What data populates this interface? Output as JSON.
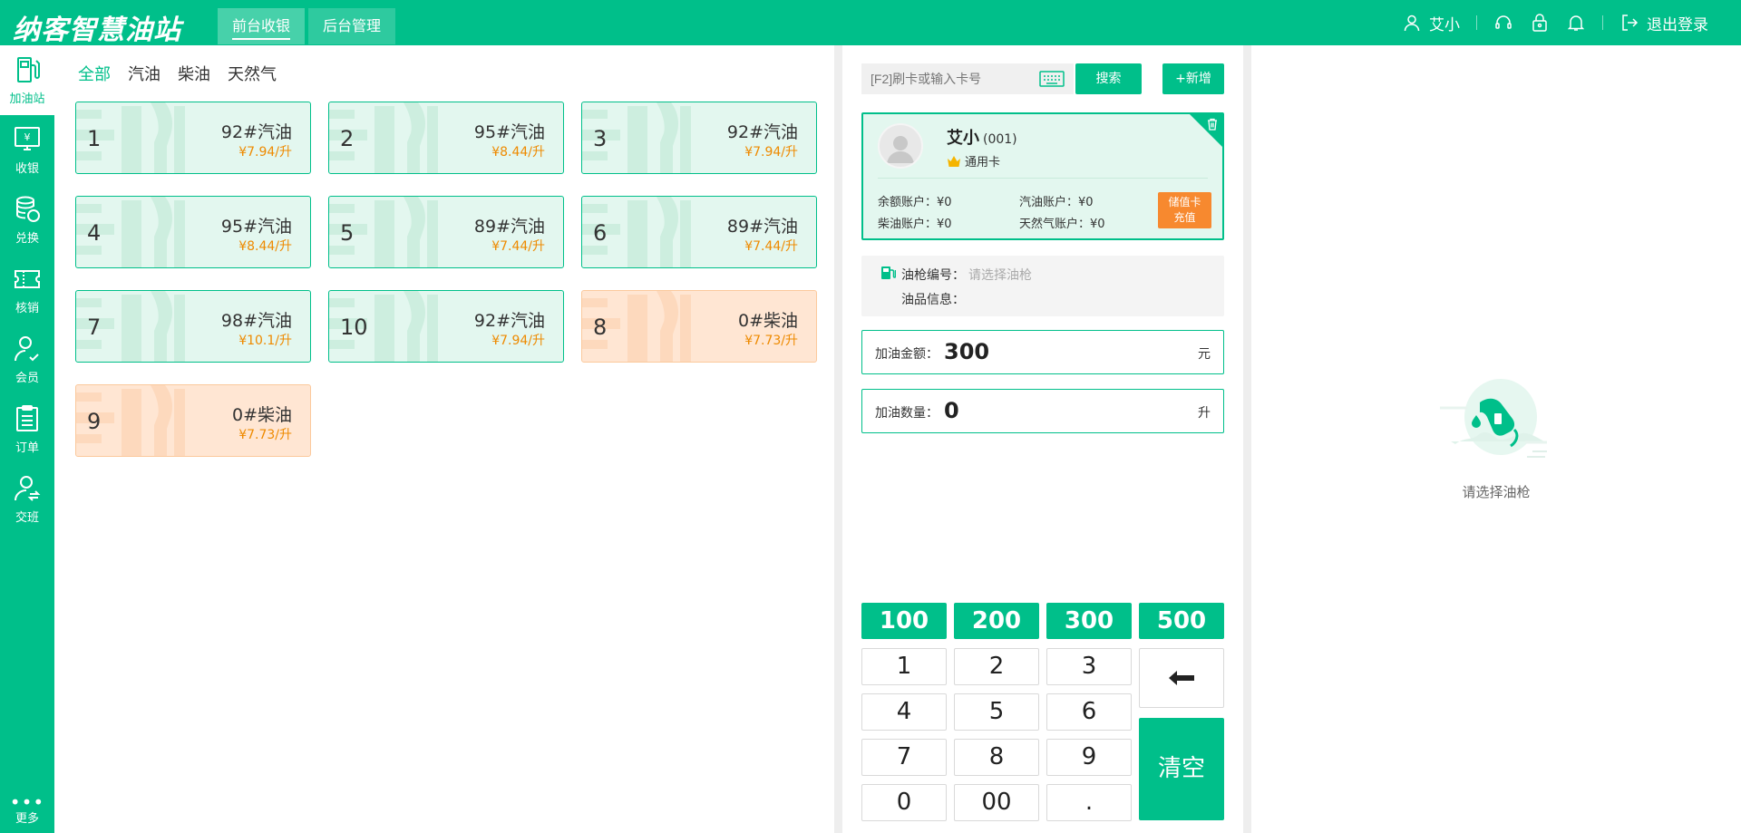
{
  "header": {
    "logo": "纳客智慧油站",
    "tabs": [
      {
        "label": "前台收银",
        "active": true
      },
      {
        "label": "后台管理",
        "active": false
      }
    ],
    "user_name": "艾小",
    "logout_label": "退出登录"
  },
  "sidebar": {
    "items": [
      {
        "label": "加油站",
        "icon": "fuel-pump-icon",
        "active": true
      },
      {
        "label": "收银",
        "icon": "cashier-icon",
        "active": false
      },
      {
        "label": "兑换",
        "icon": "exchange-icon",
        "active": false
      },
      {
        "label": "核销",
        "icon": "ticket-icon",
        "active": false
      },
      {
        "label": "会员",
        "icon": "member-icon",
        "active": false
      },
      {
        "label": "订单",
        "icon": "order-icon",
        "active": false
      },
      {
        "label": "交班",
        "icon": "shift-icon",
        "active": false
      }
    ],
    "more_label": "更多"
  },
  "filters": [
    "全部",
    "汽油",
    "柴油",
    "天然气"
  ],
  "pumps": [
    {
      "number": "1",
      "fuel": "92#汽油",
      "price": "¥7.94/升",
      "kind": "gasoline"
    },
    {
      "number": "2",
      "fuel": "95#汽油",
      "price": "¥8.44/升",
      "kind": "gasoline"
    },
    {
      "number": "3",
      "fuel": "92#汽油",
      "price": "¥7.94/升",
      "kind": "gasoline"
    },
    {
      "number": "4",
      "fuel": "95#汽油",
      "price": "¥8.44/升",
      "kind": "gasoline"
    },
    {
      "number": "5",
      "fuel": "89#汽油",
      "price": "¥7.44/升",
      "kind": "gasoline"
    },
    {
      "number": "6",
      "fuel": "89#汽油",
      "price": "¥7.44/升",
      "kind": "gasoline"
    },
    {
      "number": "7",
      "fuel": "98#汽油",
      "price": "¥10.1/升",
      "kind": "gasoline"
    },
    {
      "number": "10",
      "fuel": "92#汽油",
      "price": "¥7.94/升",
      "kind": "gasoline"
    },
    {
      "number": "8",
      "fuel": "0#柴油",
      "price": "¥7.73/升",
      "kind": "diesel"
    },
    {
      "number": "9",
      "fuel": "0#柴油",
      "price": "¥7.73/升",
      "kind": "diesel"
    }
  ],
  "search": {
    "placeholder": "[F2]刷卡或输入卡号",
    "button_label": "搜索",
    "add_label": "+新增"
  },
  "member": {
    "name": "艾小",
    "code": "(001)",
    "card_type": "通用卡",
    "balance": "余额账户：¥0",
    "gasoline": "汽油账户：¥0",
    "diesel": "柴油账户：¥0",
    "gas": "天然气账户：¥0",
    "recharge_line1": "储值卡",
    "recharge_line2": "充值"
  },
  "gun": {
    "number_label": "油枪编号：",
    "number_placeholder": "请选择油枪",
    "info_label": "油品信息："
  },
  "amount": {
    "label": "加油金额：",
    "value": "300",
    "unit": "元"
  },
  "quantity": {
    "label": "加油数量：",
    "value": "0",
    "unit": "升"
  },
  "presets": [
    "100",
    "200",
    "300",
    "500"
  ],
  "keypad": [
    "1",
    "2",
    "3",
    "4",
    "5",
    "6",
    "7",
    "8",
    "9",
    "0",
    "00",
    "."
  ],
  "clear_label": "清空",
  "empty_state": "请选择油枪",
  "colors": {
    "primary": "#00bf8a",
    "diesel_bg": "#ffe6d3",
    "price_orange": "#ee8a00",
    "recharge_orange": "#f7892f"
  }
}
